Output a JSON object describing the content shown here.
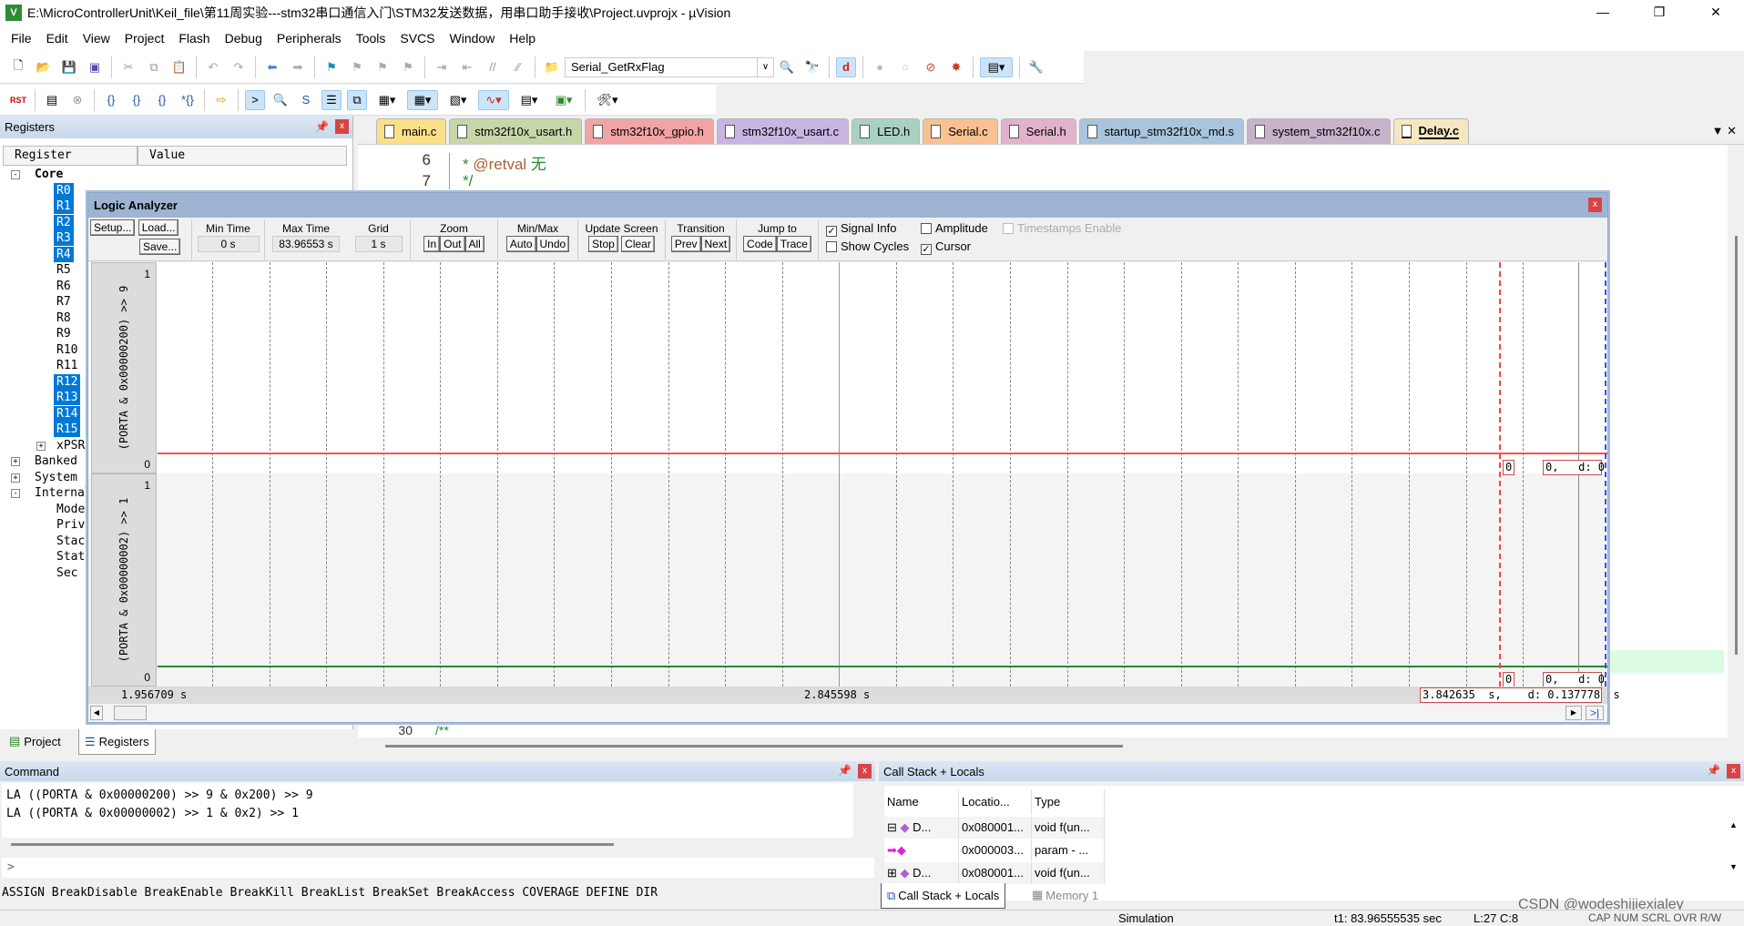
{
  "window": {
    "title": "E:\\MicroControllerUnit\\Keil_file\\第11周实验---stm32串口通信入门\\STM32发送数据，用串口助手接收\\Project.uvprojx - µVision",
    "logo": "V",
    "buttons": [
      "—",
      "❐",
      "✕"
    ]
  },
  "menu": [
    "File",
    "Edit",
    "View",
    "Project",
    "Flash",
    "Debug",
    "Peripherals",
    "Tools",
    "SVCS",
    "Window",
    "Help"
  ],
  "toolbar": {
    "find_combo": "Serial_GetRxFlag"
  },
  "registers": {
    "title": "Registers",
    "columns": [
      "Register",
      "Value"
    ],
    "tree": [
      {
        "label": "Core",
        "level": 0,
        "expand": "-",
        "bold": true
      },
      {
        "label": "R0",
        "level": 1,
        "selected": true
      },
      {
        "label": "R1",
        "level": 1,
        "selected": true
      },
      {
        "label": "R2",
        "level": 1,
        "selected": true
      },
      {
        "label": "R3",
        "level": 1,
        "selected": true
      },
      {
        "label": "R4",
        "level": 1,
        "selected": true
      },
      {
        "label": "R5",
        "level": 1
      },
      {
        "label": "R6",
        "level": 1
      },
      {
        "label": "R7",
        "level": 1
      },
      {
        "label": "R8",
        "level": 1
      },
      {
        "label": "R9",
        "level": 1
      },
      {
        "label": "R10",
        "level": 1
      },
      {
        "label": "R11",
        "level": 1
      },
      {
        "label": "R12",
        "level": 1,
        "selected": true
      },
      {
        "label": "R13",
        "level": 1,
        "selected": true
      },
      {
        "label": "R14",
        "level": 1,
        "selected": true
      },
      {
        "label": "R15",
        "level": 1,
        "selected": true
      },
      {
        "label": "xPSR",
        "level": 1,
        "expand": "+"
      },
      {
        "label": "Banked",
        "level": 0,
        "expand": "+"
      },
      {
        "label": "System",
        "level": 0,
        "expand": "+"
      },
      {
        "label": "Internal",
        "level": 0,
        "expand": "-"
      },
      {
        "label": "Mode",
        "level": 1
      },
      {
        "label": "Priv",
        "level": 1
      },
      {
        "label": "Stac",
        "level": 1
      },
      {
        "label": "Stat",
        "level": 1
      },
      {
        "label": "Sec",
        "level": 1
      }
    ],
    "tabs": [
      "Project",
      "Registers"
    ]
  },
  "editor": {
    "tabs": [
      {
        "label": "main.c",
        "color": "#fbe08a"
      },
      {
        "label": "stm32f10x_usart.h",
        "color": "#c7d6a9"
      },
      {
        "label": "stm32f10x_gpio.h",
        "color": "#f2a3a3"
      },
      {
        "label": "stm32f10x_usart.c",
        "color": "#c9b5e2"
      },
      {
        "label": "LED.h",
        "color": "#a9d1c2"
      },
      {
        "label": "Serial.c",
        "color": "#f8c190"
      },
      {
        "label": "Serial.h",
        "color": "#e2b2ca"
      },
      {
        "label": "startup_stm32f10x_md.s",
        "color": "#a9c5dd"
      },
      {
        "label": "system_stm32f10x.c",
        "color": "#c6b2ca"
      },
      {
        "label": "Delay.c",
        "color": "#f6e7c2",
        "active": true
      }
    ],
    "tab_menu": "▼ ✕",
    "lines": [
      {
        "num": "6",
        "prefix": "* ",
        "tag": "@retval",
        "text": " 无"
      },
      {
        "num": "7",
        "prefix": "*/",
        "tag": "",
        "text": ""
      }
    ],
    "bottom_line": {
      "num": "30",
      "text": "/**"
    }
  },
  "logic_analyzer": {
    "title": "Logic Analyzer",
    "buttons": {
      "setup": "Setup...",
      "load": "Load...",
      "save": "Save..."
    },
    "min_time": {
      "label": "Min Time",
      "value": "0 s"
    },
    "max_time": {
      "label": "Max Time",
      "value": "83.96553 s"
    },
    "grid": {
      "label": "Grid",
      "value": "1 s"
    },
    "zoom": {
      "label": "Zoom",
      "buttons": [
        "In",
        "Out",
        "All"
      ]
    },
    "minmax": {
      "label": "Min/Max",
      "buttons": [
        "Auto",
        "Undo"
      ]
    },
    "update": {
      "label": "Update Screen",
      "buttons": [
        "Stop",
        "Clear"
      ]
    },
    "transition": {
      "label": "Transition",
      "buttons": [
        "Prev",
        "Next"
      ]
    },
    "jump": {
      "label": "Jump to",
      "buttons": [
        "Code",
        "Trace"
      ]
    },
    "options": [
      {
        "label": "Signal Info",
        "checked": true
      },
      {
        "label": "Amplitude",
        "checked": false
      },
      {
        "label": "Timestamps Enable",
        "checked": false,
        "disabled": true
      },
      {
        "label": "Show Cycles",
        "checked": false
      },
      {
        "label": "Cursor",
        "checked": true
      }
    ],
    "signals": [
      {
        "name": "(PORTA & 0x00000200) >> 9",
        "max": "1",
        "min": "0",
        "value": 0,
        "color": "#ff4040",
        "cursor_value": "0",
        "delta_value": "0,   d: 0"
      },
      {
        "name": "(PORTA & 0x00000002) >> 1",
        "max": "1",
        "min": "0",
        "value": 0,
        "color": "#2a8a2a",
        "cursor_value": "0",
        "delta_value": "0,   d: 0"
      }
    ],
    "time_axis": {
      "left": "1.956709 s",
      "center": "2.845598 s",
      "cursor": "3.842635  s,    d: 0.137778  s"
    },
    "cursor_colors": {
      "red": "#ff4040",
      "blue": "#3050ff"
    }
  },
  "command": {
    "title": "Command",
    "lines": [
      "LA ((PORTA & 0x00000200) >> 9 & 0x200) >> 9",
      "LA ((PORTA & 0x00000002) >> 1 & 0x2) >> 1"
    ],
    "prompt": ">",
    "help": "ASSIGN BreakDisable BreakEnable BreakKill BreakList BreakSet BreakAccess COVERAGE DEFINE DIR"
  },
  "callstack": {
    "title": "Call Stack + Locals",
    "columns": [
      "Name",
      "Locatio...",
      "Type"
    ],
    "rows": [
      {
        "expand": "-",
        "name": "D...",
        "location": "0x080001...",
        "type": "void f(un..."
      },
      {
        "expand": "",
        "name": "",
        "location": "0x000003...",
        "type": "param - ..."
      },
      {
        "expand": "+",
        "name": "D...",
        "location": "0x080001...",
        "type": "void f(un..."
      }
    ],
    "tabs": [
      "Call Stack + Locals",
      "Memory 1"
    ]
  },
  "status": {
    "mode": "Simulation",
    "time": "t1: 83.96555535 sec",
    "pos": "L:27 C:8",
    "keys": "CAP NUM SCRL OVR R/W"
  },
  "watermark": "CSDN @wodeshijiexialey"
}
